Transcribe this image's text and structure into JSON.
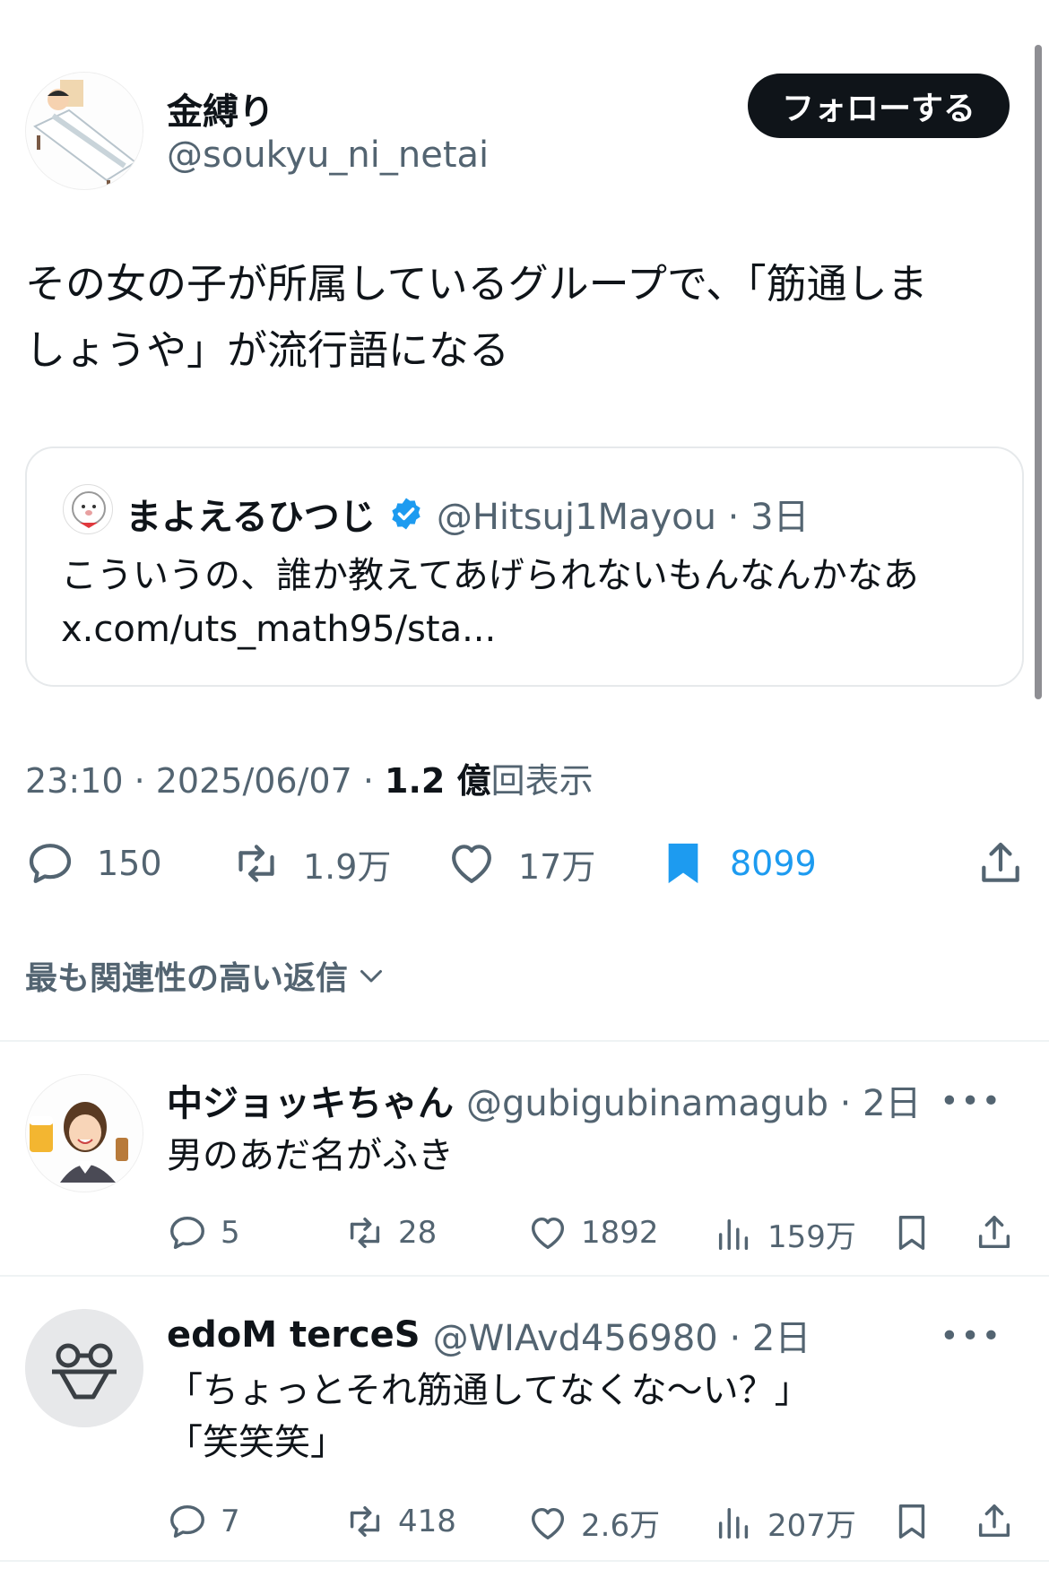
{
  "tweet": {
    "author_name": "金縛り",
    "author_handle": "@soukyu_ni_netai",
    "follow_label": "フォローする",
    "text_line1": "その女の子が所属しているグループで、「筋通しま",
    "text_line2": "しょうや」が流行語になる",
    "quote": {
      "name": "まよえるひつじ",
      "handle": "@Hitsuj1Mayou · 3日",
      "text_line1": "こういうの、誰か教えてあげられないもんなんかなあ",
      "text_line2": "x.com/uts_math95/sta..."
    },
    "time": "23:10 · 2025/06/07 · ",
    "views_count": "1.2 億",
    "views_label": "回表示",
    "stats": {
      "replies": "150",
      "retweets": "1.9万",
      "likes": "17万",
      "bookmarks": "8099"
    }
  },
  "sort_label": "最も関連性の高い返信",
  "replies": [
    {
      "name": "中ジョッキちゃん",
      "handle": "@gubigubinamagub · 2日",
      "text_line1": "男のあだ名がふき",
      "replies": "5",
      "retweets": "28",
      "likes": "1892",
      "views": "159万"
    },
    {
      "name": "edoM terceS",
      "handle": "@WIAvd456980 · 2日",
      "text_line1": "「ちょっとそれ筋通してなくな〜い？」",
      "text_line2": "「笑笑笑」",
      "replies": "7",
      "retweets": "418",
      "likes": "2.6万",
      "views": "207万"
    }
  ],
  "colors": {
    "accent": "#1d9bf0",
    "text": "#0f1419",
    "muted": "#536471"
  },
  "icons": [
    "reply-icon",
    "retweet-icon",
    "like-icon",
    "bookmark-icon",
    "share-icon",
    "views-icon",
    "more-icon",
    "verified-icon",
    "chevron-down-icon"
  ]
}
